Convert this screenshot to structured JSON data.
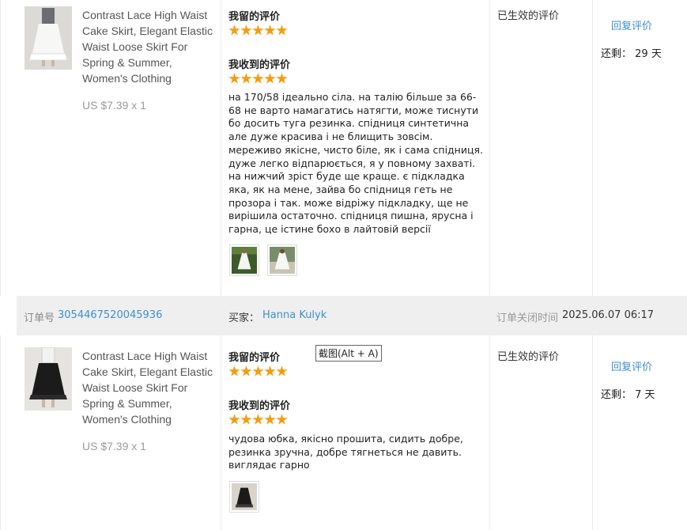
{
  "row1": {
    "product_title": "Contrast Lace High Waist Cake Skirt, Elegant Elastic Waist Loose Skirt For Spring & Summer, Women's Clothing",
    "price": "US $7.39 x 1",
    "my_review_label": "我留的评价",
    "my_rating": 5,
    "received_review_label": "我收到的评价",
    "received_rating": 5,
    "review_text": "на 170/58 ідеально сіла. на талію більше за 66-68 не варто намагатись натягти, може тиснути бо досить туга резинка. спідниця синтетична але дуже красива і не блищить зовсім. мереживо якісне, чисто біле, як і сама спідниця. дуже легко відпарюється, я у повному захваті. на нижчий зріст буде ще краще. є підкладка яка, як на мене, зайва бо спідниця геть не прозора і так. може відріжу підкладку, ще не вирішила остаточно. спідниця пишна, ярусна і гарна, це істине бохо в лайтовій версії",
    "status": "已生效的评价",
    "reply": "回复评价",
    "remain_label": "还剩：",
    "remain_value": "29 天"
  },
  "order_bar": {
    "order_label": "订单号",
    "order_no": "3054467520045936",
    "buyer_label": "买家：",
    "buyer_name": "Hanna Kulyk",
    "closed_label": "订单关闭时间",
    "closed_time": "2025.06.07 06:17"
  },
  "row2": {
    "product_title": "Contrast Lace High Waist Cake Skirt, Elegant Elastic Waist Loose Skirt For Spring & Summer, Women's Clothing",
    "price": "US $7.39 x 1",
    "my_review_label": "我留的评价",
    "my_rating": 5,
    "received_review_label": "我收到的评价",
    "received_rating": 5,
    "review_text": "чудова юбка, якісно прошита, сидить добре, резинка зручна, добре тягнеться не давить. виглядає гарно",
    "status": "已生效的评价",
    "reply": "回复评价",
    "remain_label": "还剩：",
    "remain_value": "7 天"
  },
  "tooltip": "截图(Alt + A)",
  "colors": {
    "star": "#f39c12",
    "link": "#3d8fcf",
    "bar": "#efefef"
  }
}
